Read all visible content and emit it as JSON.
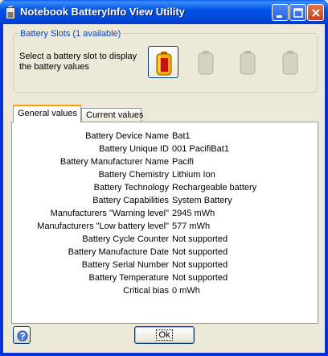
{
  "window": {
    "title": "Notebook BatteryInfo View Utility"
  },
  "slots_group": {
    "title": "Battery Slots (1 available)",
    "description": "Select a battery slot to display the battery values",
    "slots": [
      {
        "state": "active",
        "icon": "battery-charged-icon"
      },
      {
        "state": "disabled",
        "icon": "battery-empty-icon"
      },
      {
        "state": "disabled",
        "icon": "battery-empty-icon"
      },
      {
        "state": "disabled",
        "icon": "battery-empty-icon"
      }
    ]
  },
  "tabs": [
    {
      "label": "General values",
      "selected": true
    },
    {
      "label": "Current values",
      "selected": false
    }
  ],
  "general_values": [
    {
      "label": "Battery Device Name",
      "value": "Bat1"
    },
    {
      "label": "Battery Unique ID",
      "value": "001 PacifiBat1"
    },
    {
      "label": "Battery Manufacturer Name",
      "value": "Pacifi"
    },
    {
      "label": "Battery Chemistry",
      "value": "Lithium Ion"
    },
    {
      "label": "Battery Technology",
      "value": "Rechargeable battery"
    },
    {
      "label": "Battery Capabilities",
      "value": "System Battery"
    },
    {
      "label": "Manufacturers \"Warning level\"",
      "value": "2945 mWh"
    },
    {
      "label": "Manufacturers \"Low battery level\"",
      "value": "577 mWh"
    },
    {
      "label": "Battery Cycle Counter",
      "value": "Not supported"
    },
    {
      "label": "Battery Manufacture Date",
      "value": "Not supported"
    },
    {
      "label": "Battery Serial Number",
      "value": "Not supported"
    },
    {
      "label": "Battery Temperature",
      "value": "Not supported"
    },
    {
      "label": "Critical bias",
      "value": "0 mWh"
    }
  ],
  "footer": {
    "ok_label": "Ok"
  },
  "colors": {
    "titlebar": "#0055e5",
    "group_title": "#0046d5",
    "tab_highlight": "#ff9c00",
    "battery_active": "#e8a000",
    "battery_disabled": "#c8c4b4"
  }
}
